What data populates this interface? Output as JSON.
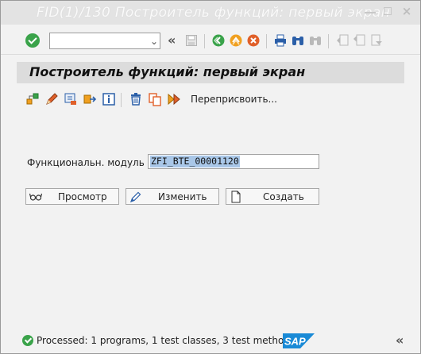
{
  "window": {
    "title": "FID(1)/130 Построитель функций: первый экран",
    "controls": {
      "minimize": "_",
      "maximize": "□",
      "close": "×"
    }
  },
  "toolbar": {
    "command_field": {
      "value": "",
      "placeholder": ""
    },
    "nav_collapse": "«",
    "icons": [
      "enter-icon",
      "save-icon",
      "back-icon",
      "exit-icon",
      "cancel-icon",
      "print-icon",
      "find-icon",
      "find-next-icon",
      "first-page-icon",
      "prev-page-icon",
      "next-page-icon"
    ]
  },
  "screen": {
    "title": "Построитель функций: первый экран"
  },
  "app_toolbar": {
    "icons": [
      "hierarchy-icon",
      "edit-icon",
      "tool-icon",
      "transport-icon",
      "info-icon",
      "delete-icon",
      "copy-icon",
      "rename-icon"
    ],
    "reassign_label": "Переприсвоить..."
  },
  "form": {
    "module_label": "Функциональн. модуль",
    "module_value": "ZFI_BTE_00001120"
  },
  "buttons": {
    "display": "Просмотр",
    "change": "Изменить",
    "create": "Создать"
  },
  "status": {
    "message": "Processed: 1 programs, 1 test classes, 3 test methods",
    "collapse": "«",
    "brand": "SAP",
    "colors": {
      "ok": "#3aa34a",
      "sap_blue": "#1a8ad6"
    }
  }
}
